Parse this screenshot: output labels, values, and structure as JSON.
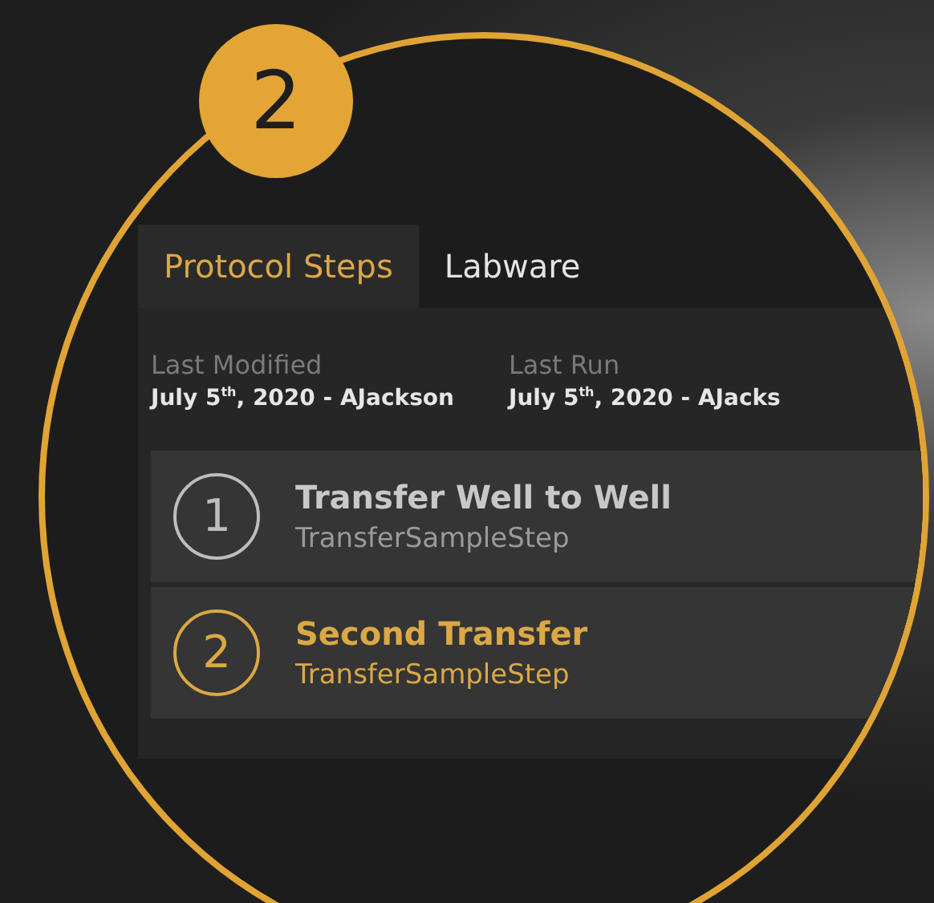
{
  "badge": {
    "label": "2"
  },
  "tabs": [
    {
      "label": "Protocol Steps",
      "selected": true
    },
    {
      "label": "Labware",
      "selected": false
    }
  ],
  "meta": [
    {
      "label": "Last Modified",
      "value": "July 5$^{th}$, 2020 - AJackson"
    },
    {
      "label": "Last Run",
      "value": "July 5$^{th}$, 2020 - AJacks"
    }
  ],
  "steps": [
    {
      "number": "1",
      "name": "Transfer Well to Well",
      "type": "TransferSampleStep",
      "selected": false
    },
    {
      "number": "2",
      "name": "Second Transfer",
      "type": "TransferSampleStep",
      "selected": true
    }
  ]
}
